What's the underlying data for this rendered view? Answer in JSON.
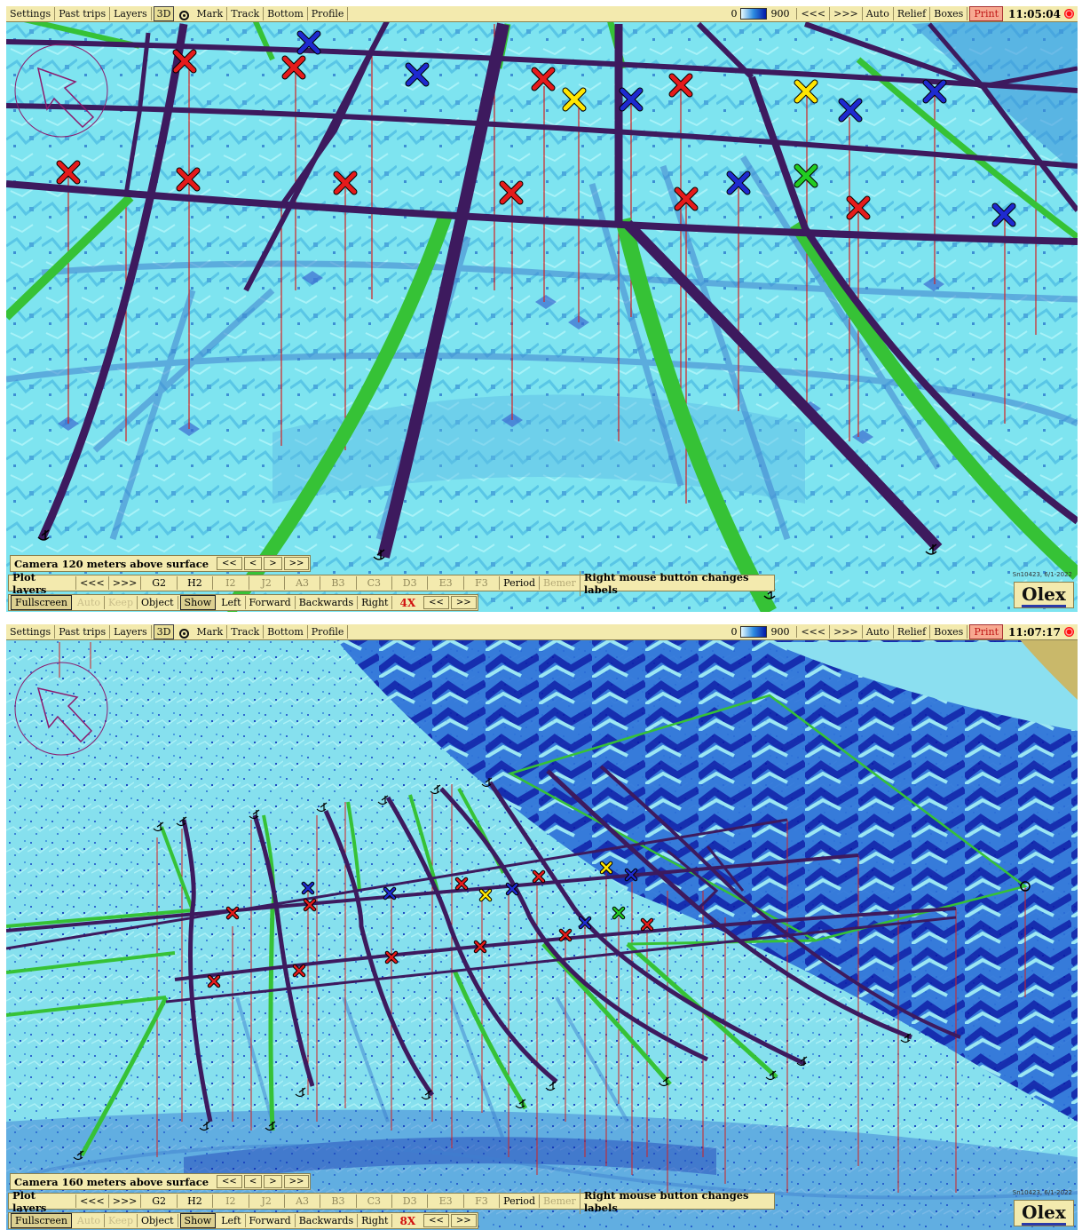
{
  "panels": [
    {
      "toolbar": {
        "items": [
          "Settings",
          "Past trips",
          "Layers",
          "3D",
          "Mark",
          "Track",
          "Bottom",
          "Profile"
        ],
        "depth_min": "0",
        "depth_max": "900",
        "right_items": [
          "<<<",
          ">>>",
          "Auto",
          "Relief",
          "Boxes"
        ],
        "print": "Print",
        "time": "11:05:04"
      },
      "camera": {
        "label": "Camera 120 meters above surface",
        "nav": [
          "<<",
          "<",
          ">",
          ">>"
        ]
      },
      "plot_layers": {
        "title": "Plot layers",
        "nav": [
          "<<<",
          ">>>"
        ],
        "layers": [
          "G2",
          "H2",
          "I2",
          "J2",
          "A3",
          "B3",
          "C3",
          "D3",
          "E3",
          "F3"
        ],
        "period": "Period",
        "bemer": "Bemer",
        "hint": "Right mouse button changes labels"
      },
      "bottom": {
        "items": [
          "Fullscreen",
          "Auto",
          "Keep",
          "Object",
          "Show",
          "Left",
          "Forward",
          "Backwards",
          "Right"
        ],
        "zoom": "4X",
        "zoom_nav": [
          "<<",
          ">>"
        ]
      },
      "stamp": "Sn10423, 6/1-2022",
      "logo": "Olex",
      "colors": {
        "red_mark": "#e51b1b",
        "blue_mark": "#1e2ad0",
        "yellow_mark": "#ffe600",
        "green_mark": "#22cc22",
        "track_purple": "#3d1a5e",
        "track_green": "#36c236"
      }
    },
    {
      "toolbar": {
        "items": [
          "Settings",
          "Past trips",
          "Layers",
          "3D",
          "Mark",
          "Track",
          "Bottom",
          "Profile"
        ],
        "depth_min": "0",
        "depth_max": "900",
        "right_items": [
          "<<<",
          ">>>",
          "Auto",
          "Relief",
          "Boxes"
        ],
        "print": "Print",
        "time": "11:07:17"
      },
      "camera": {
        "label": "Camera 160 meters above surface",
        "nav": [
          "<<",
          "<",
          ">",
          ">>"
        ]
      },
      "plot_layers": {
        "title": "Plot layers",
        "nav": [
          "<<<",
          ">>>"
        ],
        "layers": [
          "G2",
          "H2",
          "I2",
          "J2",
          "A3",
          "B3",
          "C3",
          "D3",
          "E3",
          "F3"
        ],
        "period": "Period",
        "bemer": "Bemer",
        "hint": "Right mouse button changes labels"
      },
      "bottom": {
        "items": [
          "Fullscreen",
          "Auto",
          "Keep",
          "Object",
          "Show",
          "Left",
          "Forward",
          "Backwards",
          "Right"
        ],
        "zoom": "8X",
        "zoom_nav": [
          "<<",
          ">>"
        ]
      },
      "stamp": "Sn10423, 6/1-2022",
      "logo": "Olex"
    }
  ]
}
